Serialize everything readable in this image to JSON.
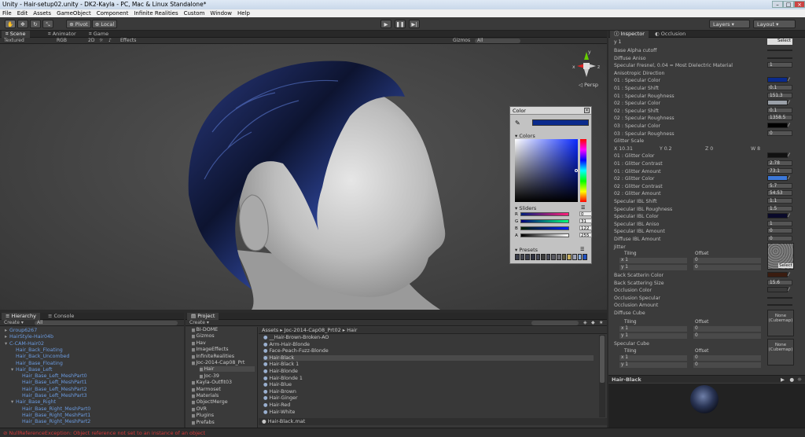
{
  "window": {
    "title": "Unity - Hair-setup02.unity - DK2-Kayla - PC, Mac & Linux Standalone*"
  },
  "menu": [
    "File",
    "Edit",
    "Assets",
    "GameObject",
    "Component",
    "Infinite Realities",
    "Custom",
    "Window",
    "Help"
  ],
  "toolbar": {
    "pivot": "Pivot",
    "local": "Local",
    "layers": "Layers",
    "layout": "Layout"
  },
  "scene": {
    "tabs": [
      "Scene",
      "Animator",
      "Game"
    ],
    "bar": {
      "shading": "Textured",
      "render": "RGB",
      "mode2d": "2D",
      "effects": "Effects",
      "gizmos": "Gizmos",
      "search": "All"
    },
    "gizmo_label": "Persp",
    "axes": {
      "x": "x",
      "y": "y",
      "z": "z"
    }
  },
  "color_window": {
    "title": "Color",
    "colors_label": "Colors",
    "sliders_label": "Sliders",
    "presets_label": "Presets",
    "current_color": "#0a2a8c",
    "sliders": [
      {
        "label": "R",
        "value": "0"
      },
      {
        "label": "G",
        "value": "31"
      },
      {
        "label": "B",
        "value": "122"
      },
      {
        "label": "A",
        "value": "255"
      }
    ],
    "presets": [
      "#3a3d4a",
      "#454852",
      "#3b3f4d",
      "#2f3240",
      "#474b5a",
      "#3d3d3d",
      "#4b4e5c",
      "#5a5a62",
      "#6b6b72",
      "#5d5a3e",
      "#c8b060",
      "#9ea4b8",
      "#8cb0e0",
      "#2050c0"
    ]
  },
  "hierarchy": {
    "tab": "Hierarchy",
    "tab2": "Console",
    "create": "Create",
    "search": "All",
    "items": [
      {
        "label": "Group6267",
        "indent": 0,
        "arrow": "▸"
      },
      {
        "label": "HairStyle-Hair04b",
        "indent": 0,
        "arrow": "▸"
      },
      {
        "label": "C-CAM-Hair02",
        "indent": 0,
        "arrow": "▾"
      },
      {
        "label": "Hair_Back_Floating",
        "indent": 1,
        "arrow": ""
      },
      {
        "label": "Hair_Back_Uncombed",
        "indent": 1,
        "arrow": ""
      },
      {
        "label": "Hair_Base_Floating",
        "indent": 1,
        "arrow": ""
      },
      {
        "label": "Hair_Base_Left",
        "indent": 1,
        "arrow": "▾"
      },
      {
        "label": "Hair_Base_Left_MeshPart0",
        "indent": 2,
        "arrow": ""
      },
      {
        "label": "Hair_Base_Left_MeshPart1",
        "indent": 2,
        "arrow": ""
      },
      {
        "label": "Hair_Base_Left_MeshPart2",
        "indent": 2,
        "arrow": ""
      },
      {
        "label": "Hair_Base_Left_MeshPart3",
        "indent": 2,
        "arrow": ""
      },
      {
        "label": "Hair_Base_Right",
        "indent": 1,
        "arrow": "▾"
      },
      {
        "label": "Hair_Base_Right_MeshPart0",
        "indent": 2,
        "arrow": ""
      },
      {
        "label": "Hair_Base_Right_MeshPart1",
        "indent": 2,
        "arrow": ""
      },
      {
        "label": "Hair_Base_Right_MeshPart2",
        "indent": 2,
        "arrow": ""
      }
    ]
  },
  "project": {
    "tab": "Project",
    "create": "Create",
    "breadcrumb": "Assets ▸ Joc-2014-Cap08_Prt02 ▸ Hair",
    "folders": [
      {
        "label": "BI-DOME",
        "indent": 0
      },
      {
        "label": "Gizmos",
        "indent": 0
      },
      {
        "label": "Hav",
        "indent": 0
      },
      {
        "label": "ImageEffects",
        "indent": 0
      },
      {
        "label": "InfiniteRealities",
        "indent": 0
      },
      {
        "label": "Joc-2014-Cap08_Prt",
        "indent": 0
      },
      {
        "label": "Hair",
        "indent": 1
      },
      {
        "label": "Joc-39",
        "indent": 1
      },
      {
        "label": "Kayla-Outfit03",
        "indent": 0
      },
      {
        "label": "Marmoset",
        "indent": 0
      },
      {
        "label": "Materials",
        "indent": 0
      },
      {
        "label": "ObjectMerge",
        "indent": 0
      },
      {
        "label": "OVR",
        "indent": 0
      },
      {
        "label": "Plugins",
        "indent": 0
      },
      {
        "label": "Prefabs",
        "indent": 0
      }
    ],
    "assets": [
      "__Hair-Brown-Broken-AO",
      "Arm-Hair-Blonde",
      "Face-Peach-Fuzz-Blonde",
      "Hair-Black",
      "Hair-Black 1",
      "Hair-Blonde",
      "Hair-Blonde 1",
      "Hair-Blue",
      "Hair-Brown",
      "Hair-Ginger",
      "Hair-Red",
      "Hair-White"
    ],
    "selected_asset": "Hair-Black",
    "footer": "Hair-Black.mat"
  },
  "inspector": {
    "tabs": [
      "Inspector",
      "Occlusion"
    ],
    "rows": [
      {
        "label": "Base Alpha cutoff",
        "kind": "slider"
      },
      {
        "label": "Diffuse Aniso",
        "kind": "slider"
      },
      {
        "label": "Specular Fresnel, 0.04 = Most Dielectric Material",
        "kind": "field",
        "value": "1"
      },
      {
        "label": "Anisotropic Direction",
        "kind": "none"
      },
      {
        "label": "01 : Specular Color",
        "kind": "color",
        "color": "#0a2a8c"
      },
      {
        "label": "01 : Specular Shift",
        "kind": "field",
        "value": "0.1"
      },
      {
        "label": "01 : Specular Roughness",
        "kind": "field",
        "value": "151.3"
      },
      {
        "label": "02 : Specular Color",
        "kind": "color",
        "color": "#9aa0a8"
      },
      {
        "label": "02 : Specular Shift",
        "kind": "field",
        "value": "0.1"
      },
      {
        "label": "02 : Specular Roughness",
        "kind": "field",
        "value": "1358.5"
      },
      {
        "label": "03 : Specular Color",
        "kind": "color",
        "color": "#000000"
      },
      {
        "label": "03 : Specular Roughness",
        "kind": "field",
        "value": "0"
      },
      {
        "label": "Glitter Scale",
        "kind": "none"
      },
      {
        "label": "X 10.31",
        "kind": "vec"
      },
      {
        "label": "01 : Glitter Color",
        "kind": "color",
        "color": "#111111"
      },
      {
        "label": "01 : Glitter Contrast",
        "kind": "field",
        "value": "2.78"
      },
      {
        "label": "01 : Glitter Amount",
        "kind": "field",
        "value": "73.1"
      },
      {
        "label": "02 : Glitter Color",
        "kind": "color",
        "color": "#3c78d8"
      },
      {
        "label": "02 : Glitter Contrast",
        "kind": "field",
        "value": "5.7"
      },
      {
        "label": "02 : Glitter Amount",
        "kind": "field",
        "value": "54.53"
      },
      {
        "label": "Specular IBL Shift",
        "kind": "field",
        "value": "1.1"
      },
      {
        "label": "Specular IBL Roughness",
        "kind": "field",
        "value": "1.5"
      },
      {
        "label": "Specular IBL Color",
        "kind": "color",
        "color": "#0a0a2a"
      },
      {
        "label": "Specular IBL Aniso",
        "kind": "field",
        "value": "1"
      },
      {
        "label": "Specular IBL Amount",
        "kind": "field",
        "value": "0"
      },
      {
        "label": "Diffuse IBL Amount",
        "kind": "field",
        "value": "0"
      },
      {
        "label": "Jitter",
        "kind": "none"
      }
    ],
    "glitter_vec": {
      "x": "X 10.31",
      "y": "Y 0.2",
      "z": "Z 0",
      "w": "W 8"
    },
    "tiling_label": "Tiling",
    "offset_label": "Offset",
    "tiling_x": {
      "x": "x 1",
      "o": "0"
    },
    "tiling_y": {
      "y": "y 1",
      "o": "0"
    },
    "select": "Select",
    "lower_rows": [
      {
        "label": "Back Scatterin Color",
        "kind": "color",
        "color": "#3a1c10"
      },
      {
        "label": "Back Scattering Size",
        "kind": "field",
        "value": "15.6"
      },
      {
        "label": "Occlusion Color",
        "kind": "color",
        "color": "#3b3b3b"
      },
      {
        "label": "Occlusion Specular",
        "kind": "slider"
      },
      {
        "label": "Occlusion Amount",
        "kind": "slider"
      },
      {
        "label": "Diffuse Cube",
        "kind": "none"
      }
    ],
    "cube_none": "None",
    "cube_type": "(Cubemap)",
    "specular_cube": "Specular Cube",
    "preview_title": "Hair-Black"
  },
  "status": {
    "message": "NullReferenceException: Object reference not set to an instance of an object"
  }
}
